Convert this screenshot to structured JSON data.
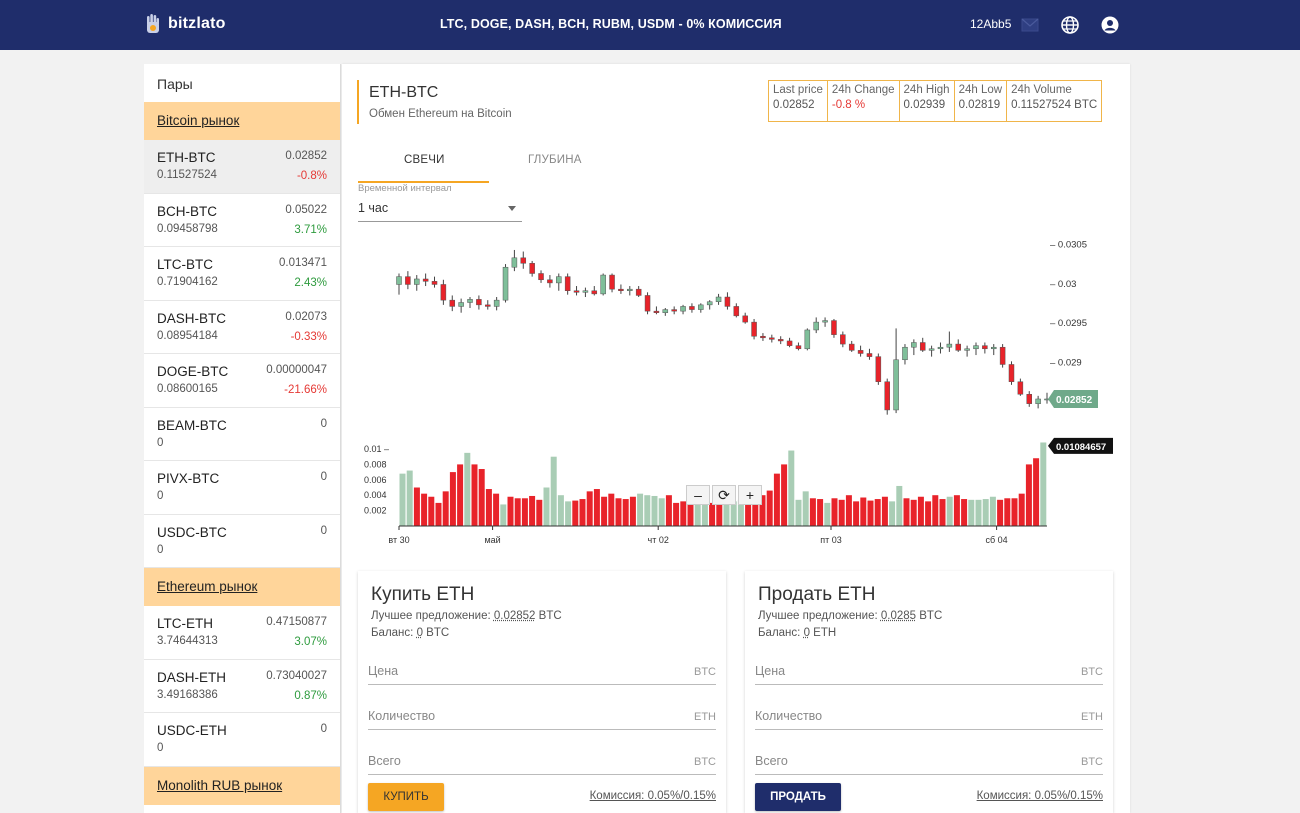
{
  "header": {
    "logo_text": "bitzlato",
    "promo": "LTC, DOGE, DASH, BCH, RUBM, USDM - 0% КОМИССИЯ",
    "user_id": "12Abb5",
    "icons": [
      "mail-icon",
      "globe-icon",
      "account-icon"
    ]
  },
  "sidebar": {
    "title": "Пары",
    "markets": [
      {
        "name": "Bitcoin рынок",
        "pairs": [
          {
            "pair": "ETH-BTC",
            "volume": "0.11527524",
            "price": "0.02852",
            "change": "-0.8%",
            "trend": "neg",
            "active": true
          },
          {
            "pair": "BCH-BTC",
            "volume": "0.09458798",
            "price": "0.05022",
            "change": "3.71%",
            "trend": "pos"
          },
          {
            "pair": "LTC-BTC",
            "volume": "0.71904162",
            "price": "0.013471",
            "change": "2.43%",
            "trend": "pos"
          },
          {
            "pair": "DASH-BTC",
            "volume": "0.08954184",
            "price": "0.02073",
            "change": "-0.33%",
            "trend": "neg"
          },
          {
            "pair": "DOGE-BTC",
            "volume": "0.08600165",
            "price": "0.00000047",
            "change": "-21.66%",
            "trend": "neg"
          },
          {
            "pair": "BEAM-BTC",
            "volume": "0",
            "price": "0",
            "change": "",
            "trend": ""
          },
          {
            "pair": "PIVX-BTC",
            "volume": "0",
            "price": "0",
            "change": "",
            "trend": ""
          },
          {
            "pair": "USDC-BTC",
            "volume": "0",
            "price": "0",
            "change": "",
            "trend": ""
          }
        ]
      },
      {
        "name": "Ethereum рынок",
        "pairs": [
          {
            "pair": "LTC-ETH",
            "volume": "3.74644313",
            "price": "0.47150877",
            "change": "3.07%",
            "trend": "pos"
          },
          {
            "pair": "DASH-ETH",
            "volume": "3.49168386",
            "price": "0.73040027",
            "change": "0.87%",
            "trend": "pos"
          },
          {
            "pair": "USDC-ETH",
            "volume": "0",
            "price": "0",
            "change": "",
            "trend": ""
          }
        ]
      },
      {
        "name": "Monolith RUB рынок",
        "pairs": []
      }
    ]
  },
  "main": {
    "title": "ETH-BTC",
    "subtitle": "Обмен Ethereum на Bitcoin",
    "stats": [
      {
        "label": "Last price",
        "value": "0.02852",
        "color": "#555555"
      },
      {
        "label": "24h Change",
        "value": "-0.8 %",
        "color": "#e53935"
      },
      {
        "label": "24h High",
        "value": "0.02939",
        "color": "#555555"
      },
      {
        "label": "24h Low",
        "value": "0.02819",
        "color": "#555555"
      },
      {
        "label": "24h Volume",
        "value": "0.11527524 BTC",
        "color": "#555555"
      }
    ],
    "tabs": [
      "СВЕЧИ",
      "ГЛУБИНА"
    ],
    "interval_label": "Временной интервал",
    "interval_value": "1 час",
    "zoom": [
      "–",
      "⟳",
      "+"
    ]
  },
  "chart_data": {
    "type": "candlestick",
    "price_ticks": [
      "0.0305",
      "0.03",
      "0.0295",
      "0.029"
    ],
    "price_ylim": [
      0.02815,
      0.0307
    ],
    "volume_ticks": [
      "0.01",
      "0.008",
      "0.006",
      "0.004",
      "0.002"
    ],
    "volume_ylim": [
      0,
      0.0105
    ],
    "x_ticks": [
      "вт 30",
      "май",
      "чт 02",
      "пт 03",
      "сб 04"
    ],
    "x_tick_index": [
      0,
      13,
      36,
      60,
      83
    ],
    "last_price_label": "0.02852",
    "last_volume_label": "0.01084657",
    "up_color": "#7fbf9a",
    "down_color": "#e8232a",
    "candles": [
      [
        0.02998,
        0.03012,
        0.02985,
        0.03008
      ],
      [
        0.03008,
        0.03015,
        0.02992,
        0.02998
      ],
      [
        0.02998,
        0.0301,
        0.0299,
        0.03005
      ],
      [
        0.03005,
        0.03012,
        0.02996,
        0.03002
      ],
      [
        0.03002,
        0.03008,
        0.02994,
        0.02998
      ],
      [
        0.02998,
        0.03004,
        0.02972,
        0.02978
      ],
      [
        0.02978,
        0.02984,
        0.02964,
        0.0297
      ],
      [
        0.0297,
        0.0298,
        0.02962,
        0.02975
      ],
      [
        0.02975,
        0.02982,
        0.02968,
        0.02979
      ],
      [
        0.02979,
        0.02984,
        0.02966,
        0.02972
      ],
      [
        0.02972,
        0.02978,
        0.02966,
        0.0297
      ],
      [
        0.0297,
        0.02982,
        0.02965,
        0.02978
      ],
      [
        0.02978,
        0.03024,
        0.02975,
        0.0302
      ],
      [
        0.0302,
        0.03042,
        0.03015,
        0.03032
      ],
      [
        0.03032,
        0.0304,
        0.03018,
        0.03025
      ],
      [
        0.03025,
        0.03028,
        0.03008,
        0.03012
      ],
      [
        0.03012,
        0.03016,
        0.03,
        0.03004
      ],
      [
        0.03004,
        0.0301,
        0.02994,
        0.03
      ],
      [
        0.03,
        0.03012,
        0.0299,
        0.03008
      ],
      [
        0.03008,
        0.03012,
        0.02985,
        0.0299
      ],
      [
        0.0299,
        0.02996,
        0.02984,
        0.02988
      ],
      [
        0.02988,
        0.02994,
        0.02982,
        0.0299
      ],
      [
        0.0299,
        0.02996,
        0.02984,
        0.02986
      ],
      [
        0.02986,
        0.03012,
        0.02984,
        0.0301
      ],
      [
        0.0301,
        0.03012,
        0.02988,
        0.02992
      ],
      [
        0.02992,
        0.02998,
        0.02986,
        0.0299
      ],
      [
        0.0299,
        0.02996,
        0.02984,
        0.02992
      ],
      [
        0.02992,
        0.02996,
        0.02982,
        0.02984
      ],
      [
        0.02984,
        0.02988,
        0.0296,
        0.02964
      ],
      [
        0.02964,
        0.0297,
        0.0296,
        0.02962
      ],
      [
        0.02962,
        0.02968,
        0.02958,
        0.02966
      ],
      [
        0.02966,
        0.0297,
        0.0296,
        0.02964
      ],
      [
        0.02964,
        0.02972,
        0.0296,
        0.0297
      ],
      [
        0.0297,
        0.02974,
        0.02962,
        0.02966
      ],
      [
        0.02966,
        0.02974,
        0.02962,
        0.02972
      ],
      [
        0.02972,
        0.02978,
        0.02966,
        0.02976
      ],
      [
        0.02976,
        0.02986,
        0.02972,
        0.02982
      ],
      [
        0.02982,
        0.02988,
        0.02966,
        0.0297
      ],
      [
        0.0297,
        0.02974,
        0.02956,
        0.02958
      ],
      [
        0.02958,
        0.02962,
        0.02948,
        0.0295
      ],
      [
        0.0295,
        0.02954,
        0.02928,
        0.02932
      ],
      [
        0.02932,
        0.02936,
        0.02926,
        0.0293
      ],
      [
        0.0293,
        0.02934,
        0.02924,
        0.02928
      ],
      [
        0.02928,
        0.02932,
        0.02922,
        0.02926
      ],
      [
        0.02926,
        0.0293,
        0.02918,
        0.0292
      ],
      [
        0.0292,
        0.02924,
        0.02914,
        0.02916
      ],
      [
        0.02916,
        0.02942,
        0.02914,
        0.0294
      ],
      [
        0.0294,
        0.02956,
        0.02936,
        0.0295
      ],
      [
        0.0295,
        0.02956,
        0.02944,
        0.02952
      ],
      [
        0.02952,
        0.02954,
        0.0293,
        0.02934
      ],
      [
        0.02934,
        0.02938,
        0.02918,
        0.02922
      ],
      [
        0.02922,
        0.02926,
        0.02912,
        0.02914
      ],
      [
        0.02914,
        0.0292,
        0.02906,
        0.0291
      ],
      [
        0.0291,
        0.02916,
        0.02902,
        0.02906
      ],
      [
        0.02906,
        0.0291,
        0.0287,
        0.02874
      ],
      [
        0.02874,
        0.02878,
        0.02832,
        0.02838
      ],
      [
        0.02838,
        0.02942,
        0.02834,
        0.02902
      ],
      [
        0.02902,
        0.02922,
        0.02896,
        0.02918
      ],
      [
        0.02918,
        0.02928,
        0.02908,
        0.02924
      ],
      [
        0.02924,
        0.0293,
        0.02912,
        0.02914
      ],
      [
        0.02914,
        0.0292,
        0.02906,
        0.02916
      ],
      [
        0.02916,
        0.02924,
        0.0291,
        0.02918
      ],
      [
        0.02918,
        0.02938,
        0.02912,
        0.02922
      ],
      [
        0.02922,
        0.02928,
        0.02912,
        0.02914
      ],
      [
        0.02914,
        0.0292,
        0.02906,
        0.02916
      ],
      [
        0.02916,
        0.02924,
        0.02908,
        0.0292
      ],
      [
        0.0292,
        0.02924,
        0.0291,
        0.02916
      ],
      [
        0.02916,
        0.02922,
        0.02908,
        0.02918
      ],
      [
        0.02918,
        0.02922,
        0.02892,
        0.02896
      ],
      [
        0.02896,
        0.029,
        0.0287,
        0.02874
      ],
      [
        0.02874,
        0.02878,
        0.02856,
        0.02858
      ],
      [
        0.02858,
        0.02862,
        0.02842,
        0.02846
      ],
      [
        0.02846,
        0.02856,
        0.0284,
        0.02852
      ],
      [
        0.02852,
        0.0286,
        0.02846,
        0.02852
      ]
    ],
    "volumes": [
      [
        0.0068,
        "up"
      ],
      [
        0.0072,
        "up"
      ],
      [
        0.005,
        "down"
      ],
      [
        0.0042,
        "down"
      ],
      [
        0.0038,
        "down"
      ],
      [
        0.003,
        "down"
      ],
      [
        0.0045,
        "down"
      ],
      [
        0.007,
        "down"
      ],
      [
        0.008,
        "down"
      ],
      [
        0.0095,
        "up"
      ],
      [
        0.008,
        "down"
      ],
      [
        0.0074,
        "down"
      ],
      [
        0.0048,
        "down"
      ],
      [
        0.0042,
        "down"
      ],
      [
        0.0028,
        "up"
      ],
      [
        0.0038,
        "down"
      ],
      [
        0.0036,
        "down"
      ],
      [
        0.0036,
        "down"
      ],
      [
        0.0039,
        "down"
      ],
      [
        0.0034,
        "down"
      ],
      [
        0.005,
        "up"
      ],
      [
        0.009,
        "up"
      ],
      [
        0.004,
        "up"
      ],
      [
        0.0032,
        "up"
      ],
      [
        0.0033,
        "down"
      ],
      [
        0.0035,
        "down"
      ],
      [
        0.0045,
        "down"
      ],
      [
        0.0048,
        "down"
      ],
      [
        0.0038,
        "down"
      ],
      [
        0.0042,
        "down"
      ],
      [
        0.0036,
        "down"
      ],
      [
        0.0035,
        "down"
      ],
      [
        0.0038,
        "down"
      ],
      [
        0.0042,
        "up"
      ],
      [
        0.004,
        "up"
      ],
      [
        0.0039,
        "up"
      ],
      [
        0.0036,
        "up"
      ],
      [
        0.004,
        "down"
      ],
      [
        0.003,
        "down"
      ],
      [
        0.0032,
        "down"
      ],
      [
        0.0034,
        "down"
      ],
      [
        0.0036,
        "up"
      ],
      [
        0.0032,
        "up"
      ],
      [
        0.003,
        "down"
      ],
      [
        0.0034,
        "down"
      ],
      [
        0.0028,
        "up"
      ],
      [
        0.0032,
        "up"
      ],
      [
        0.0034,
        "up"
      ],
      [
        0.0032,
        "down"
      ],
      [
        0.0035,
        "down"
      ],
      [
        0.004,
        "down"
      ],
      [
        0.0046,
        "down"
      ],
      [
        0.0068,
        "down"
      ],
      [
        0.008,
        "down"
      ],
      [
        0.0098,
        "up"
      ],
      [
        0.0034,
        "up"
      ],
      [
        0.0045,
        "up"
      ],
      [
        0.0036,
        "down"
      ],
      [
        0.0035,
        "down"
      ],
      [
        0.003,
        "up"
      ],
      [
        0.0036,
        "down"
      ],
      [
        0.0034,
        "down"
      ],
      [
        0.004,
        "down"
      ],
      [
        0.0032,
        "down"
      ],
      [
        0.0037,
        "down"
      ],
      [
        0.0033,
        "down"
      ],
      [
        0.0035,
        "down"
      ],
      [
        0.0038,
        "down"
      ],
      [
        0.0032,
        "up"
      ],
      [
        0.0052,
        "up"
      ],
      [
        0.0036,
        "down"
      ],
      [
        0.0034,
        "down"
      ],
      [
        0.0038,
        "down"
      ],
      [
        0.0032,
        "down"
      ],
      [
        0.004,
        "down"
      ],
      [
        0.0035,
        "down"
      ],
      [
        0.0038,
        "up"
      ],
      [
        0.004,
        "down"
      ],
      [
        0.0035,
        "down"
      ],
      [
        0.0034,
        "up"
      ],
      [
        0.0034,
        "up"
      ],
      [
        0.0035,
        "up"
      ],
      [
        0.0038,
        "up"
      ],
      [
        0.0034,
        "down"
      ],
      [
        0.0036,
        "down"
      ],
      [
        0.0036,
        "down"
      ],
      [
        0.0042,
        "down"
      ],
      [
        0.008,
        "down"
      ],
      [
        0.0088,
        "down"
      ],
      [
        0.01084657,
        "up"
      ]
    ]
  },
  "buy": {
    "title": "Купить ETH",
    "best_label": "Лучшее предложение:",
    "best_value": "0.02852",
    "best_unit": "BTC",
    "balance_label": "Баланс:",
    "balance_value": "0",
    "balance_unit": "BTC",
    "price_ph": "Цена",
    "price_unit": "BTC",
    "qty_ph": "Количество",
    "qty_unit": "ETH",
    "total_ph": "Всего",
    "total_unit": "BTC",
    "button": "КУПИТЬ",
    "fee": "Комиссия: 0.05%/0.15%"
  },
  "sell": {
    "title": "Продать ETH",
    "best_label": "Лучшее предложение:",
    "best_value": "0.0285",
    "best_unit": "BTC",
    "balance_label": "Баланс:",
    "balance_value": "0",
    "balance_unit": "ETH",
    "price_ph": "Цена",
    "price_unit": "BTC",
    "qty_ph": "Количество",
    "qty_unit": "ETH",
    "total_ph": "Всего",
    "total_unit": "BTC",
    "button": "ПРОДАТЬ",
    "fee": "Комиссия: 0.05%/0.15%"
  }
}
